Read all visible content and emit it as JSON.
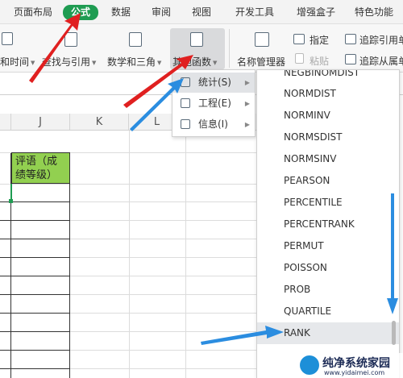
{
  "ribbon_tabs": [
    "页面布局",
    "公式",
    "数据",
    "审阅",
    "视图",
    "开发工具",
    "增强盒子",
    "特色功能"
  ],
  "active_tab": "公式",
  "ribbon": {
    "date_time": "和时间",
    "lookup": "查找与引用",
    "math": "数学和三角",
    "other": "其他函数",
    "name_manager": "名称管理器",
    "define": "指定",
    "paste": "粘贴",
    "trace_precedents": "追踪引用单",
    "trace_dependents": "追踪从属单"
  },
  "columns": [
    "J",
    "K",
    "L"
  ],
  "header_cell": "评语（成绩等级）",
  "submenu": {
    "items": [
      {
        "label": "统计(S)",
        "icon": "chart-icon"
      },
      {
        "label": "工程(E)",
        "icon": "engineering-icon"
      },
      {
        "label": "信息(I)",
        "icon": "info-icon"
      }
    ]
  },
  "functions": [
    "NEGBINOMDIST",
    "NORMDIST",
    "NORMINV",
    "NORMSDIST",
    "NORMSINV",
    "PEARSON",
    "PERCENTILE",
    "PERCENTRANK",
    "PERMUT",
    "POISSON",
    "PROB",
    "QUARTILE",
    "RANK"
  ],
  "selected_function": "RANK",
  "watermark": {
    "title": "纯净系统家园",
    "url": "www.yidaimei.com"
  },
  "colors": {
    "accent": "#1f9c52",
    "arrow_red": "#e02020",
    "arrow_blue": "#2b8de0",
    "header_fill": "#92d050"
  }
}
